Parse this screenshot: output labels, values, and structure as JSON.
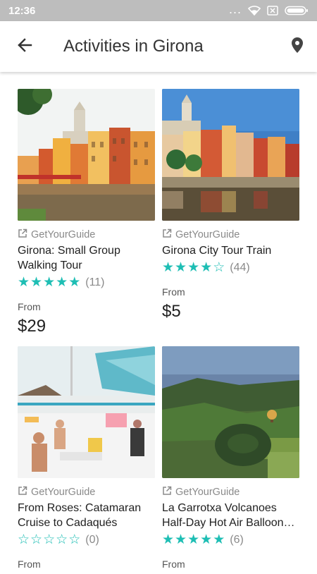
{
  "status_bar": {
    "time": "12:36",
    "dots": "...",
    "icons": [
      "wifi-icon",
      "sim-off-icon",
      "battery-icon"
    ]
  },
  "app_bar": {
    "title": "Activities in Girona",
    "back_icon": "arrow-left-icon",
    "map_icon": "map-pin-icon"
  },
  "colors": {
    "accent": "#1ebeb4",
    "status_bar": "#bdbdbd",
    "muted_text": "#8a8a8a"
  },
  "activities": [
    {
      "provider": "GetYourGuide",
      "title": "Girona: Small Group Walking Tour",
      "rating": 5,
      "review_count": "(11)",
      "from_label": "From",
      "price": "$29"
    },
    {
      "provider": "GetYourGuide",
      "title": "Girona City Tour Train",
      "rating": 4,
      "review_count": "(44)",
      "from_label": "From",
      "price": "$5"
    },
    {
      "provider": "GetYourGuide",
      "title": "From Roses: Catamaran Cruise to Cadaqués",
      "rating": 0,
      "review_count": "(0)",
      "from_label": "From",
      "price": ""
    },
    {
      "provider": "GetYourGuide",
      "title": "La Garrotxa Volcanoes Half-Day Hot Air Balloon…",
      "rating": 5,
      "review_count": "(6)",
      "from_label": "From",
      "price": ""
    }
  ]
}
